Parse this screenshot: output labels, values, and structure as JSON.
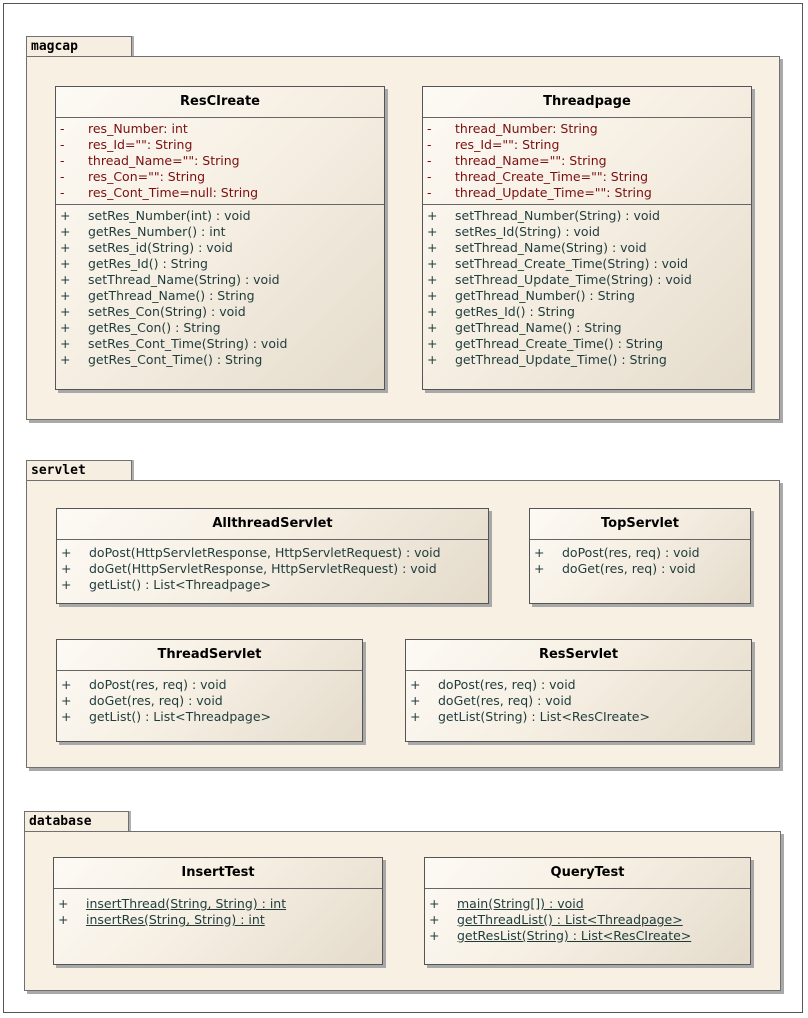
{
  "packages": [
    {
      "name": "magcap",
      "classes": [
        {
          "name": "ResCIreate",
          "attributes": [
            {
              "vis": "-",
              "text": "res_Number:  int"
            },
            {
              "vis": "-",
              "text": "res_Id=\"\":  String"
            },
            {
              "vis": "-",
              "text": "thread_Name=\"\":  String"
            },
            {
              "vis": "-",
              "text": "res_Con=\"\":  String"
            },
            {
              "vis": "-",
              "text": "res_Cont_Time=null:  String"
            }
          ],
          "operations": [
            {
              "vis": "+",
              "text": "setRes_Number(int) : void"
            },
            {
              "vis": "+",
              "text": "getRes_Number() : int"
            },
            {
              "vis": "+",
              "text": "setRes_id(String) : void"
            },
            {
              "vis": "+",
              "text": "getRes_Id() : String"
            },
            {
              "vis": "+",
              "text": "setThread_Name(String) : void"
            },
            {
              "vis": "+",
              "text": "getThread_Name() : String"
            },
            {
              "vis": "+",
              "text": "setRes_Con(String) : void"
            },
            {
              "vis": "+",
              "text": "getRes_Con() : String"
            },
            {
              "vis": "+",
              "text": "setRes_Cont_Time(String) : void"
            },
            {
              "vis": "+",
              "text": "getRes_Cont_Time() : String"
            }
          ]
        },
        {
          "name": "Threadpage",
          "attributes": [
            {
              "vis": "-",
              "text": "thread_Number:  String"
            },
            {
              "vis": "-",
              "text": "res_Id=\"\":  String"
            },
            {
              "vis": "-",
              "text": "thread_Name=\"\":  String"
            },
            {
              "vis": "-",
              "text": "thread_Create_Time=\"\":  String"
            },
            {
              "vis": "-",
              "text": "thread_Update_Time=\"\":  String"
            }
          ],
          "operations": [
            {
              "vis": "+",
              "text": "setThread_Number(String) : void"
            },
            {
              "vis": "+",
              "text": "setRes_Id(String) : void"
            },
            {
              "vis": "+",
              "text": "setThread_Name(String) : void"
            },
            {
              "vis": "+",
              "text": "setThread_Create_Time(String) : void"
            },
            {
              "vis": "+",
              "text": "setThread_Update_Time(String) : void"
            },
            {
              "vis": "+",
              "text": "getThread_Number() : String"
            },
            {
              "vis": "+",
              "text": "getRes_Id() : String"
            },
            {
              "vis": "+",
              "text": "getThread_Name() : String"
            },
            {
              "vis": "+",
              "text": "getThread_Create_Time() : String"
            },
            {
              "vis": "+",
              "text": "getThread_Update_Time() : String"
            }
          ]
        }
      ]
    },
    {
      "name": "servlet",
      "classes": [
        {
          "name": "AllthreadServlet",
          "operations": [
            {
              "vis": "+",
              "text": "doPost(HttpServletResponse, HttpServletRequest) : void"
            },
            {
              "vis": "+",
              "text": "doGet(HttpServletResponse, HttpServletRequest) : void"
            },
            {
              "vis": "+",
              "text": "getList() : List<Threadpage>"
            }
          ]
        },
        {
          "name": "TopServlet",
          "operations": [
            {
              "vis": "+",
              "text": "doPost(res, req) : void"
            },
            {
              "vis": "+",
              "text": "doGet(res, req) : void"
            }
          ]
        },
        {
          "name": "ThreadServlet",
          "operations": [
            {
              "vis": "+",
              "text": "doPost(res, req) : void"
            },
            {
              "vis": "+",
              "text": "doGet(res, req) : void"
            },
            {
              "vis": "+",
              "text": "getList() : List<Threadpage>"
            }
          ]
        },
        {
          "name": "ResServlet",
          "operations": [
            {
              "vis": "+",
              "text": "doPost(res, req) : void"
            },
            {
              "vis": "+",
              "text": "doGet(res, req) : void"
            },
            {
              "vis": "+",
              "text": "getList(String) : List<ResCIreate>"
            }
          ]
        }
      ]
    },
    {
      "name": "database",
      "classes": [
        {
          "name": "InsertTest",
          "operations": [
            {
              "vis": "+",
              "text": "insertThread(String, String) : int"
            },
            {
              "vis": "+",
              "text": "insertRes(String, String) : int"
            }
          ]
        },
        {
          "name": "QueryTest",
          "operations": [
            {
              "vis": "+",
              "text": "main(String[]) : void"
            },
            {
              "vis": "+",
              "text": "getThreadList() : List<Threadpage>"
            },
            {
              "vis": "+",
              "text": "getResList(String) : List<ResCIreate>"
            }
          ]
        }
      ]
    }
  ]
}
